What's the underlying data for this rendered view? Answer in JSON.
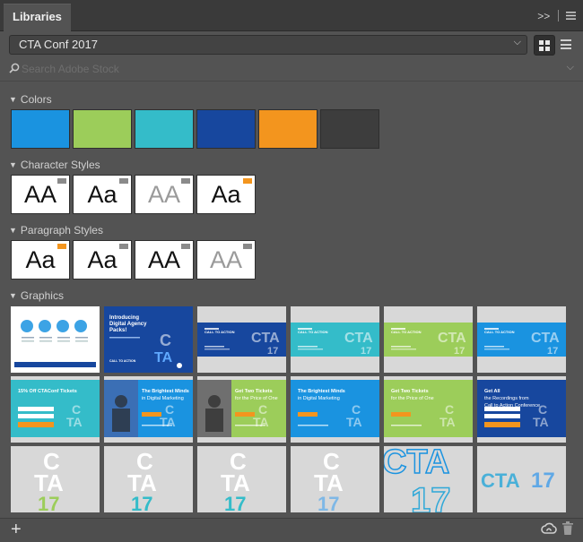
{
  "panel": {
    "tab_label": "Libraries",
    "menu_chevrons": ">>"
  },
  "library": {
    "selected": "CTA Conf 2017"
  },
  "search": {
    "placeholder": "Search Adobe Stock"
  },
  "sections": {
    "colors": {
      "title": "Colors",
      "swatches": [
        "#1a93e0",
        "#9ccd5a",
        "#34bcc9",
        "#17479e",
        "#f3951e",
        "#3d3d3d"
      ]
    },
    "character_styles": {
      "title": "Character Styles",
      "items": [
        {
          "sample": "AA",
          "text_color": "#111111",
          "corner_color": "#8a8a8a"
        },
        {
          "sample": "Aa",
          "text_color": "#111111",
          "corner_color": "#8a8a8a"
        },
        {
          "sample": "AA",
          "text_color": "#9a9a9a",
          "corner_color": "#8a8a8a"
        },
        {
          "sample": "Aa",
          "text_color": "#111111",
          "corner_color": "#f3951e"
        }
      ]
    },
    "paragraph_styles": {
      "title": "Paragraph Styles",
      "items": [
        {
          "sample": "Aa",
          "text_color": "#111111",
          "corner_color": "#f3951e"
        },
        {
          "sample": "Aa",
          "text_color": "#111111",
          "corner_color": "#8a8a8a"
        },
        {
          "sample": "AA",
          "text_color": "#111111",
          "corner_color": "#8a8a8a"
        },
        {
          "sample": "AA",
          "text_color": "#9a9a9a",
          "corner_color": "#8a8a8a"
        }
      ]
    },
    "graphics": {
      "title": "Graphics",
      "items": [
        {
          "name": "infographic-circles",
          "texts": []
        },
        {
          "name": "introducing-digital-agency-packs",
          "texts": [
            "Introducing",
            "Digital Agency",
            "Packs!",
            "CALL TO ACTION"
          ]
        },
        {
          "name": "cta-banner-navy",
          "texts": [
            "CALL TO ACTION"
          ]
        },
        {
          "name": "cta-banner-teal",
          "texts": [
            "CALL TO ACTION"
          ]
        },
        {
          "name": "cta-banner-green",
          "texts": [
            "CALL TO ACTION"
          ]
        },
        {
          "name": "cta-banner-blue",
          "texts": [
            "CALL TO ACTION"
          ]
        },
        {
          "name": "form-teal",
          "texts": [
            "15% Off CTAConf Tickets"
          ]
        },
        {
          "name": "brightest-minds-photo",
          "texts": [
            "The Brightest Minds",
            "in Digital Marketing"
          ]
        },
        {
          "name": "two-tickets-photo",
          "texts": [
            "Get Two Tickets",
            "for the Price of One"
          ]
        },
        {
          "name": "brightest-minds-blue",
          "texts": [
            "The Brightest Minds",
            "in Digital Marketing"
          ]
        },
        {
          "name": "two-tickets-green",
          "texts": [
            "Get Two Tickets",
            "for the Price of One"
          ]
        },
        {
          "name": "get-all-recordings",
          "texts": [
            "Get All",
            "the Recordings from",
            "Call to Action Conference"
          ]
        },
        {
          "name": "cta-logo-green",
          "texts": [
            "C",
            "TA",
            "17"
          ]
        },
        {
          "name": "cta-logo-teal",
          "texts": [
            "C",
            "TA",
            "17"
          ]
        },
        {
          "name": "cta-logo-teal-2",
          "texts": [
            "C",
            "TA",
            "17"
          ]
        },
        {
          "name": "cta-logo-blue",
          "texts": [
            "C",
            "TA",
            "17"
          ]
        },
        {
          "name": "cta-logo-large",
          "texts": [
            "CTA",
            "17"
          ]
        },
        {
          "name": "cta-logo-wide",
          "texts": [
            "CTA",
            "17"
          ]
        }
      ]
    }
  },
  "icons": {
    "add": "plus-icon",
    "creative_cloud": "creative-cloud-icon",
    "trash": "trash-icon",
    "search": "search-icon",
    "panel_menu": "hamburger-menu-icon"
  }
}
